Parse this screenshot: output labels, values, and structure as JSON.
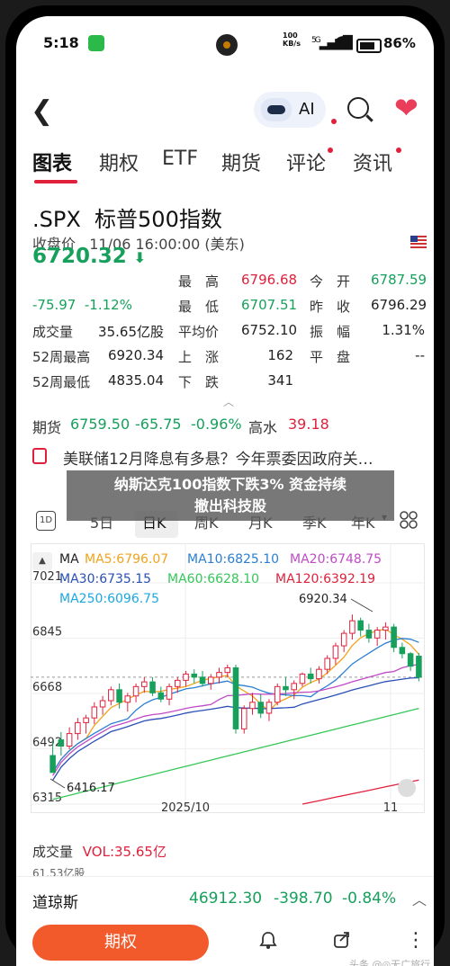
{
  "status_bar": {
    "time": "5:18",
    "network": "100\nKB/s",
    "net_type": "5G",
    "battery": "86%"
  },
  "nav": {
    "ai_label": "AI"
  },
  "tabs": [
    {
      "label": "图表",
      "active": true
    },
    {
      "label": "期权"
    },
    {
      "label": "ETF"
    },
    {
      "label": "期货"
    },
    {
      "label": "评论",
      "dot": true
    },
    {
      "label": "资讯",
      "dot": true
    }
  ],
  "instrument": {
    "title": ".SPX  标普500指数",
    "subtitle": "收盘价   11/06 16:00:00 (美东)",
    "price": "6720.32",
    "arrow": "⬇",
    "change": "-75.97  -1.12%"
  },
  "quote": {
    "high_label": "最　高",
    "high": "6796.68",
    "open_label": "今　开",
    "open": "6787.59",
    "low_label": "最　低",
    "low": "6707.51",
    "prev_label": "昨　收",
    "prev": "6796.29",
    "vol_label": "成交量",
    "vol": "35.65亿股",
    "avg_label": "平均价",
    "avg": "6752.10",
    "amp_label": "振　幅",
    "amp": "1.31%",
    "wk52h_label": "52周最高",
    "wk52h": "6920.34",
    "rise_label": "上　涨",
    "rise": "162",
    "flat_label": "平　盘",
    "flat": "--",
    "wk52l_label": "52周最低",
    "wk52l": "4835.04",
    "fall_label": "下　跌",
    "fall": "341"
  },
  "futures": {
    "label": "期货",
    "price": "6759.50",
    "change": "-65.75",
    "pct": "-0.96%",
    "high_label": "高水",
    "high": "39.18"
  },
  "news": {
    "text": "美联储12月降息有多悬？今年票委因政府关…"
  },
  "overlay": {
    "line1": "纳斯达克100指数下跌3% 资金持续",
    "line2": "撤出科技股"
  },
  "periods": {
    "d1": "1D",
    "items": [
      "5日",
      "日K",
      "周K",
      "月K",
      "季K",
      "年K"
    ],
    "active": "日K",
    "year_suffix": "▾"
  },
  "legend": {
    "ma": "MA",
    "ma5": "MA5:6796.07",
    "ma10": "MA10:6825.10",
    "ma20": "MA20:6748.75",
    "ma30": "MA30:6735.15",
    "ma60": "MA60:6628.10",
    "ma120": "MA120:6392.19",
    "ma250": "MA250:6096.75"
  },
  "colors": {
    "up": "#e0213c",
    "down": "#16a05c",
    "ma5": "#f2a31d",
    "ma10": "#2a7fd4",
    "ma20": "#c04bc6",
    "ma30": "#2a4fb7",
    "ma60": "#35c759",
    "ma120": "#e0213c",
    "ma250": "#1da7e0"
  },
  "chart_data": {
    "type": "candlestick",
    "y_ticks": [
      "7021",
      "6845",
      "6668",
      "6492",
      "6315"
    ],
    "x_ticks": [
      "2025/10",
      "11"
    ],
    "annotations": [
      "6920.34",
      "6416.17"
    ],
    "ylim": [
      6315,
      7021
    ],
    "ohlc": [
      [
        6470,
        6520,
        6420,
        6416
      ],
      [
        6520,
        6545,
        6470,
        6500
      ],
      [
        6500,
        6560,
        6490,
        6540
      ],
      [
        6540,
        6590,
        6520,
        6575
      ],
      [
        6575,
        6600,
        6540,
        6590
      ],
      [
        6590,
        6640,
        6570,
        6625
      ],
      [
        6625,
        6660,
        6600,
        6645
      ],
      [
        6645,
        6690,
        6630,
        6680
      ],
      [
        6680,
        6700,
        6620,
        6640
      ],
      [
        6640,
        6670,
        6610,
        6660
      ],
      [
        6660,
        6700,
        6640,
        6690
      ],
      [
        6690,
        6720,
        6670,
        6705
      ],
      [
        6705,
        6720,
        6660,
        6670
      ],
      [
        6670,
        6690,
        6640,
        6650
      ],
      [
        6650,
        6700,
        6630,
        6690
      ],
      [
        6690,
        6720,
        6670,
        6710
      ],
      [
        6710,
        6740,
        6690,
        6730
      ],
      [
        6730,
        6745,
        6700,
        6720
      ],
      [
        6720,
        6740,
        6690,
        6700
      ],
      [
        6700,
        6730,
        6680,
        6720
      ],
      [
        6720,
        6750,
        6700,
        6735
      ],
      [
        6735,
        6760,
        6720,
        6750
      ],
      [
        6750,
        6760,
        6540,
        6555
      ],
      [
        6555,
        6630,
        6540,
        6620
      ],
      [
        6620,
        6670,
        6600,
        6640
      ],
      [
        6640,
        6665,
        6590,
        6605
      ],
      [
        6605,
        6650,
        6580,
        6640
      ],
      [
        6640,
        6700,
        6630,
        6690
      ],
      [
        6690,
        6720,
        6660,
        6680
      ],
      [
        6680,
        6710,
        6650,
        6700
      ],
      [
        6700,
        6735,
        6690,
        6730
      ],
      [
        6730,
        6750,
        6700,
        6715
      ],
      [
        6715,
        6755,
        6700,
        6745
      ],
      [
        6745,
        6790,
        6730,
        6780
      ],
      [
        6780,
        6830,
        6760,
        6820
      ],
      [
        6820,
        6870,
        6800,
        6860
      ],
      [
        6860,
        6920,
        6840,
        6900
      ],
      [
        6900,
        6910,
        6850,
        6870
      ],
      [
        6870,
        6890,
        6830,
        6845
      ],
      [
        6845,
        6880,
        6820,
        6870
      ],
      [
        6870,
        6895,
        6840,
        6880
      ],
      [
        6880,
        6890,
        6800,
        6815
      ],
      [
        6815,
        6830,
        6780,
        6795
      ],
      [
        6795,
        6800,
        6740,
        6755
      ],
      [
        6787,
        6797,
        6707,
        6720
      ]
    ]
  },
  "volume": {
    "label": "成交量",
    "value": "VOL:35.65亿",
    "ytick": "61.53亿股"
  },
  "ticker": {
    "name": "道琼斯",
    "price": "46912.30",
    "change": "-398.70",
    "pct": "-0.84%"
  },
  "bottom": {
    "trade_label": "期权",
    "watermark": "头条 @◎无广旅行"
  }
}
